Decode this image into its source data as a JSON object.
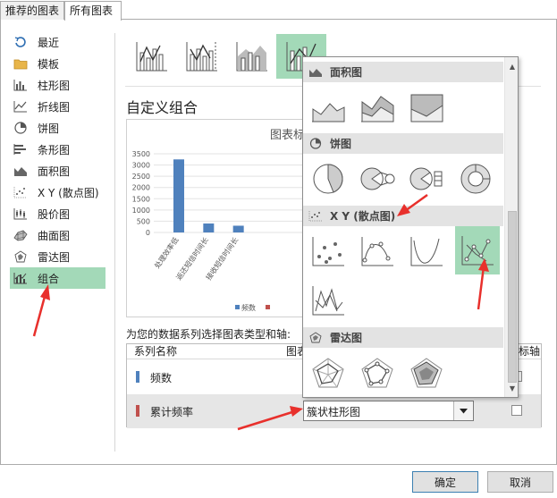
{
  "tabs": [
    {
      "label": "推荐的图表"
    },
    {
      "label": "所有图表"
    }
  ],
  "sidebar": {
    "items": [
      {
        "label": "最近",
        "icon": "recent-icon"
      },
      {
        "label": "模板",
        "icon": "folder-icon"
      },
      {
        "label": "柱形图",
        "icon": "column-chart-icon"
      },
      {
        "label": "折线图",
        "icon": "line-chart-icon"
      },
      {
        "label": "饼图",
        "icon": "pie-chart-icon"
      },
      {
        "label": "条形图",
        "icon": "bar-chart-icon"
      },
      {
        "label": "面积图",
        "icon": "area-chart-icon"
      },
      {
        "label": "X Y (散点图)",
        "icon": "scatter-chart-icon"
      },
      {
        "label": "股价图",
        "icon": "stock-chart-icon"
      },
      {
        "label": "曲面图",
        "icon": "surface-chart-icon"
      },
      {
        "label": "雷达图",
        "icon": "radar-chart-icon"
      },
      {
        "label": "组合",
        "icon": "combo-chart-icon",
        "selected": true
      }
    ]
  },
  "main": {
    "title": "自定义组合",
    "preview": {
      "title": "图表标"
    },
    "series_prompt": "为您的数据系列选择图表类型和轴:",
    "table": {
      "headers": {
        "name": "系列名称",
        "type": "图表",
        "axis": "标轴"
      },
      "rows": [
        {
          "name": "频数",
          "color": "#4f81bd"
        },
        {
          "name": "累计频率",
          "color": "#c0504d",
          "chart_type": "簇状柱形图"
        }
      ]
    }
  },
  "dropdown": {
    "categories": [
      {
        "label": "面积图",
        "icon": "area-chart-icon"
      },
      {
        "label": "饼图",
        "icon": "pie-chart-icon"
      },
      {
        "label": "X Y (散点图)",
        "icon": "scatter-chart-icon"
      },
      {
        "label": "雷达图",
        "icon": "radar-chart-icon"
      }
    ]
  },
  "buttons": {
    "ok": "确定",
    "cancel": "取消"
  },
  "colors": {
    "selected": "#a3d9b8",
    "arrow": "#e8302c",
    "series1": "#4f81bd",
    "series2": "#c0504d"
  },
  "chart_data": {
    "type": "bar",
    "categories": [
      "处理效率低",
      "返还短信时间长",
      "接收短信时间长"
    ],
    "series": [
      {
        "name": "频数",
        "values": [
          3250,
          400,
          300
        ]
      }
    ],
    "y_ticks": [
      "3500",
      "3000",
      "2500",
      "2000",
      "1500",
      "1000",
      "500",
      "0"
    ],
    "ylim": [
      0,
      3500
    ],
    "legend": [
      "频数"
    ]
  }
}
